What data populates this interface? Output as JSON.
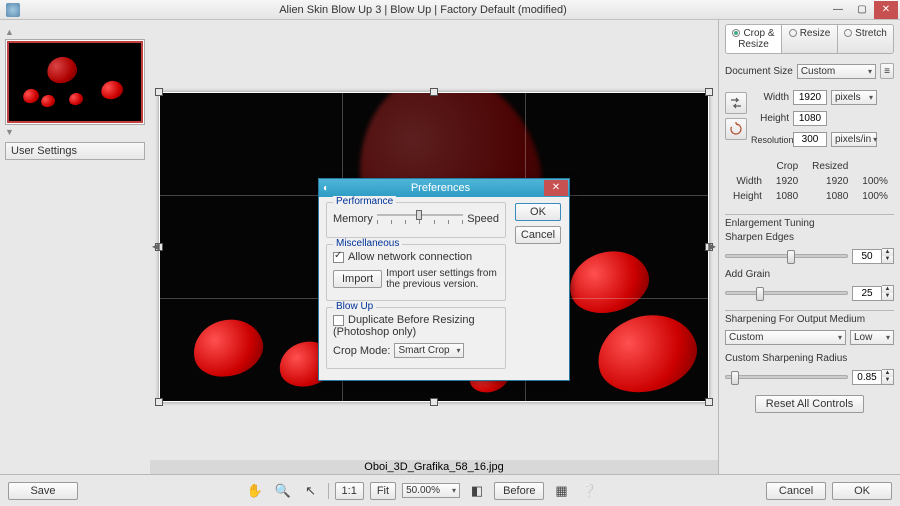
{
  "window": {
    "title": "Alien Skin Blow Up 3 | Blow Up | Factory Default (modified)"
  },
  "left": {
    "user_settings": "User Settings"
  },
  "filename": "Oboi_3D_Grafika_58_16.jpg",
  "right": {
    "tabs": {
      "crop": "Crop & Resize",
      "resize": "Resize",
      "stretch": "Stretch"
    },
    "doc_size_label": "Document Size",
    "doc_size_value": "Custom",
    "width_label": "Width",
    "width_value": "1920",
    "height_label": "Height",
    "height_value": "1080",
    "resolution_label": "Resolution",
    "resolution_value": "300",
    "unit_px": "pixels",
    "unit_res": "pixels/in",
    "table": {
      "crop": "Crop",
      "resized": "Resized",
      "w": "Width",
      "h": "Height",
      "w_crop": "1920",
      "w_res": "1920",
      "w_pct": "100%",
      "h_crop": "1080",
      "h_res": "1080",
      "h_pct": "100%"
    },
    "enlarge": "Enlargement Tuning",
    "sharpen_edges": "Sharpen Edges",
    "sharpen_val": "50",
    "add_grain": "Add Grain",
    "grain_val": "25",
    "output": "Sharpening For Output Medium",
    "output_sel": "Custom",
    "output_level": "Low",
    "radius_label": "Custom Sharpening Radius",
    "radius_val": "0.85",
    "reset": "Reset All Controls"
  },
  "dialog": {
    "title": "Preferences",
    "ok": "OK",
    "cancel": "Cancel",
    "perf": {
      "legend": "Performance",
      "memory": "Memory",
      "speed": "Speed"
    },
    "misc": {
      "legend": "Miscellaneous",
      "allow": "Allow network connection",
      "import": "Import",
      "import_desc": "Import user settings from the previous version."
    },
    "blowup": {
      "legend": "Blow Up",
      "dup": "Duplicate Before Resizing (Photoshop only)",
      "cropmode": "Crop Mode:",
      "cropmode_val": "Smart Crop"
    }
  },
  "footer": {
    "save": "Save",
    "one": "1:1",
    "fit": "Fit",
    "zoom": "50.00%",
    "before": "Before",
    "cancel": "Cancel",
    "ok": "OK"
  }
}
